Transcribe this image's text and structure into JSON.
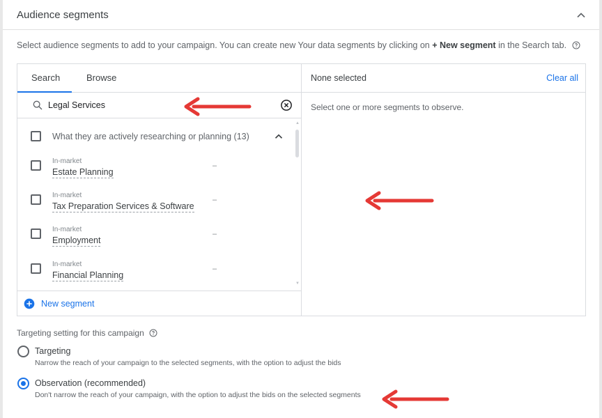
{
  "header": {
    "title": "Audience segments"
  },
  "intro": {
    "text_before": "Select audience segments to add to your campaign. You can create new Your data segments by clicking on",
    "bold": "+ New segment",
    "text_after": "in the Search tab."
  },
  "tabs": [
    {
      "label": "Search",
      "active": true
    },
    {
      "label": "Browse",
      "active": false
    }
  ],
  "search": {
    "value": "Legal Services"
  },
  "group": {
    "label": "What they are actively researching or planning (13)"
  },
  "items": [
    {
      "category": "In-market",
      "name": "Estate Planning",
      "value": "–"
    },
    {
      "category": "In-market",
      "name": "Tax Preparation Services & Software",
      "value": "–"
    },
    {
      "category": "In-market",
      "name": "Employment",
      "value": "–"
    },
    {
      "category": "In-market",
      "name": "Financial Planning",
      "value": "–"
    }
  ],
  "new_segment": {
    "label": "New segment"
  },
  "selected_panel": {
    "title": "None selected",
    "clear_all": "Clear all",
    "hint": "Select one or more segments to observe."
  },
  "targeting": {
    "label": "Targeting setting for this campaign",
    "options": [
      {
        "title": "Targeting",
        "desc": "Narrow the reach of your campaign to the selected segments, with the option to adjust the bids",
        "selected": false
      },
      {
        "title": "Observation (recommended)",
        "desc": "Don't narrow the reach of your campaign, with the option to adjust the bids on the selected segments",
        "selected": true
      }
    ]
  },
  "colors": {
    "accent": "#1a73e8",
    "annotation_arrow": "#e53935"
  }
}
